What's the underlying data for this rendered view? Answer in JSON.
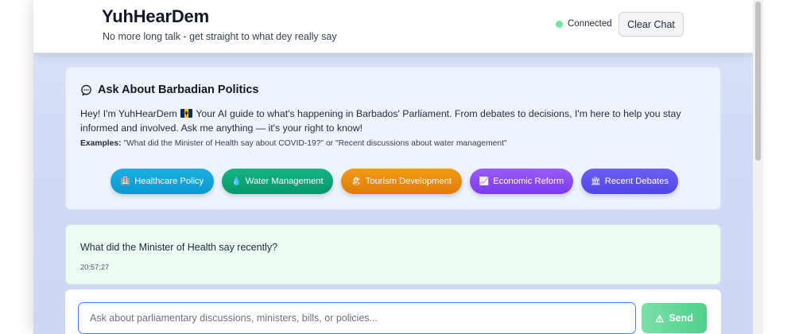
{
  "header": {
    "title": "YuhHearDem",
    "subtitle": "No more long talk - get straight to what dey really say",
    "status_label": "Connected",
    "status_color": "#6ee7a0",
    "clear_label": "Clear Chat"
  },
  "info": {
    "icon": "speech-bubble-icon",
    "title": "Ask About Barbadian Politics",
    "greeting_before_flag": "Hey! I'm YuhHearDem",
    "flag_icon": "barbados-flag-icon",
    "greeting_after_flag": "Your AI guide to what's happening in Barbados' Parliament. From debates to decisions, I'm here to help you stay informed and involved. Ask me anything — it's your right to know!",
    "examples_label": "Examples:",
    "examples_text": "\"What did the Minister of Health say about COVID-19?\" or \"Recent discussions about water management\""
  },
  "chips": [
    {
      "icon": "🏥",
      "label": "Healthcare Policy",
      "color": "#0ea5e9"
    },
    {
      "icon": "💧",
      "label": "Water Management",
      "color": "#059669"
    },
    {
      "icon": "🏖",
      "label": "Tourism Development",
      "color": "#ea8a0c"
    },
    {
      "icon": "📈",
      "label": "Economic Reform",
      "color": "#7c3aed"
    },
    {
      "icon": "🏛",
      "label": "Recent Debates",
      "color": "#4f46e5"
    }
  ],
  "message": {
    "text": "What did the Minister of Health say recently?",
    "time": "20:57:27"
  },
  "composer": {
    "placeholder": "Ask about parliamentary discussions, ministers, bills, or policies...",
    "send_icon": "⚠",
    "send_label": "Send"
  }
}
